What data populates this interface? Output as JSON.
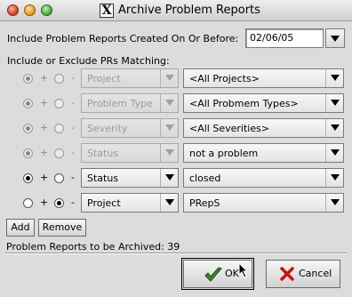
{
  "window": {
    "title": "Archive Problem Reports",
    "x_icon": "X"
  },
  "date_filter": {
    "label": "Include Problem Reports Created On Or Before:",
    "value": "02/06/05"
  },
  "criteria_label": "Include or Exclude PRs Matching:",
  "rows": [
    {
      "include": true,
      "enabled": false,
      "plus": "+",
      "minus": "-",
      "field": "Project",
      "value": "<All Projects>"
    },
    {
      "include": true,
      "enabled": false,
      "plus": "+",
      "minus": "-",
      "field": "Problem Type",
      "value": "<All Probmem Types>"
    },
    {
      "include": true,
      "enabled": false,
      "plus": "+",
      "minus": "-",
      "field": "Severity",
      "value": "<All Severities>"
    },
    {
      "include": true,
      "enabled": false,
      "plus": "+",
      "minus": "-",
      "field": "Status",
      "value": "not a problem"
    },
    {
      "include": true,
      "enabled": true,
      "plus": "+",
      "minus": "-",
      "field": "Status",
      "value": "closed"
    },
    {
      "include": false,
      "enabled": true,
      "plus": "+",
      "minus": "-",
      "field": "Project",
      "value": "PRepS"
    }
  ],
  "buttons": {
    "add": "Add",
    "remove": "Remove",
    "ok": "OK",
    "cancel": "Cancel"
  },
  "summary": {
    "label": "Problem Reports to be Archived:",
    "count": "39"
  },
  "icons": {
    "ok": "checkmark-icon",
    "cancel": "x-cancel-icon"
  },
  "colors": {
    "background": "#dcdcdc",
    "cancel_icon": "#cc1010",
    "ok_icon": "#3a8a2a"
  }
}
